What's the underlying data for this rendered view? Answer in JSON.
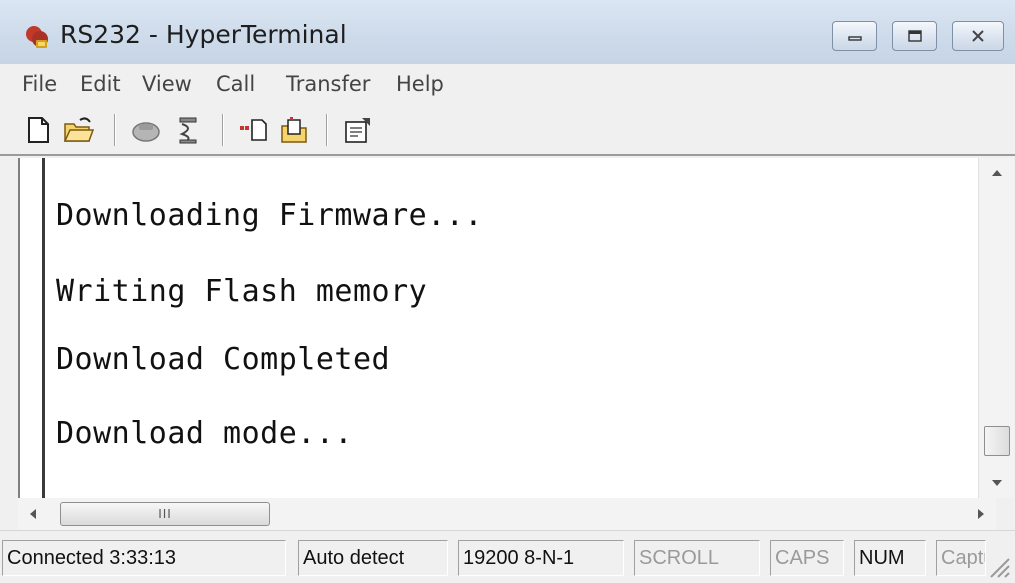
{
  "window": {
    "title": "RS232 - HyperTerminal",
    "icon": "hyperterminal-phone-icon"
  },
  "menu": {
    "items": [
      "File",
      "Edit",
      "View",
      "Call",
      "Transfer",
      "Help"
    ]
  },
  "toolbar": {
    "buttons": [
      "new-icon",
      "open-icon",
      "connect-icon",
      "disconnect-icon",
      "send-icon",
      "receive-icon",
      "properties-icon"
    ]
  },
  "terminal": {
    "lines": [
      "Downloading Firmware...",
      "Writing Flash memory",
      "Download Completed",
      "Download mode..."
    ]
  },
  "statusbar": {
    "connected": "Connected 3:33:13",
    "detect": "Auto detect",
    "settings": "19200 8-N-1",
    "scroll": "SCROLL",
    "caps": "CAPS",
    "num": "NUM",
    "capture": "Capture"
  },
  "scrollbar": {
    "grip": "III"
  },
  "colors": {
    "titlebar": "#cfdceb",
    "terminal_bg": "#ffffff",
    "text": "#111111"
  }
}
